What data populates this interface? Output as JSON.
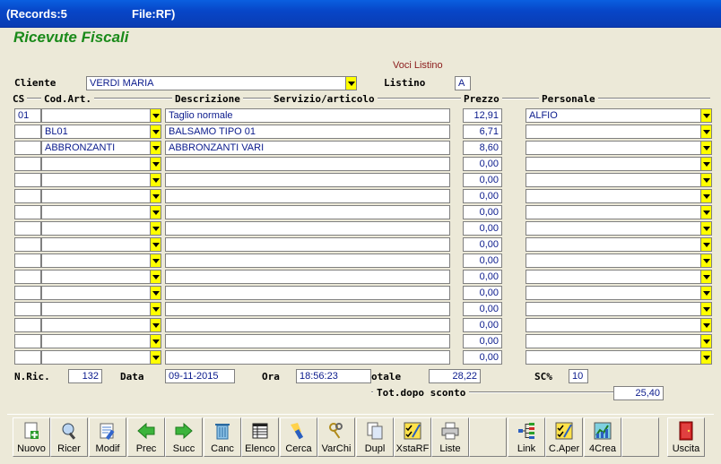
{
  "window": {
    "records": "(Records:5",
    "file": "File:RF)"
  },
  "app_title": "Ricevute Fiscali",
  "voci_listino": "Voci Listino",
  "cliente": {
    "label": "Cliente",
    "value": "VERDI MARIA"
  },
  "listino": {
    "label": "Listino",
    "value": "A"
  },
  "columns": {
    "cs": "CS",
    "cod": "Cod.Art.",
    "desc": "Descrizione",
    "serv": "Servizio/articolo",
    "prezzo": "Prezzo",
    "pers": "Personale"
  },
  "rows": [
    {
      "cs": "01",
      "cod": "",
      "desc": "Taglio normale",
      "prezzo": "12,91",
      "pers": "ALFIO"
    },
    {
      "cs": "",
      "cod": "BL01",
      "desc": "BALSAMO TIPO 01",
      "prezzo": "6,71",
      "pers": ""
    },
    {
      "cs": "",
      "cod": "ABBRONZANTI",
      "desc": "ABBRONZANTI VARI",
      "prezzo": "8,60",
      "pers": ""
    },
    {
      "cs": "",
      "cod": "",
      "desc": "",
      "prezzo": "0,00",
      "pers": ""
    },
    {
      "cs": "",
      "cod": "",
      "desc": "",
      "prezzo": "0,00",
      "pers": ""
    },
    {
      "cs": "",
      "cod": "",
      "desc": "",
      "prezzo": "0,00",
      "pers": ""
    },
    {
      "cs": "",
      "cod": "",
      "desc": "",
      "prezzo": "0,00",
      "pers": ""
    },
    {
      "cs": "",
      "cod": "",
      "desc": "",
      "prezzo": "0,00",
      "pers": ""
    },
    {
      "cs": "",
      "cod": "",
      "desc": "",
      "prezzo": "0,00",
      "pers": ""
    },
    {
      "cs": "",
      "cod": "",
      "desc": "",
      "prezzo": "0,00",
      "pers": ""
    },
    {
      "cs": "",
      "cod": "",
      "desc": "",
      "prezzo": "0,00",
      "pers": ""
    },
    {
      "cs": "",
      "cod": "",
      "desc": "",
      "prezzo": "0,00",
      "pers": ""
    },
    {
      "cs": "",
      "cod": "",
      "desc": "",
      "prezzo": "0,00",
      "pers": ""
    },
    {
      "cs": "",
      "cod": "",
      "desc": "",
      "prezzo": "0,00",
      "pers": ""
    },
    {
      "cs": "",
      "cod": "",
      "desc": "",
      "prezzo": "0,00",
      "pers": ""
    },
    {
      "cs": "",
      "cod": "",
      "desc": "",
      "prezzo": "0,00",
      "pers": ""
    }
  ],
  "footer": {
    "nric_label": "N.Ric.",
    "nric": "132",
    "data_label": "Data",
    "data": "09-11-2015",
    "ora_label": "Ora",
    "ora": "18:56:23",
    "totale_label": "otale",
    "totale": "28,22",
    "sc_label": "SC%",
    "sc": "10",
    "tot_dopo_label": "Tot.dopo sconto",
    "tot_dopo": "25,40"
  },
  "toolbar": [
    {
      "name": "nuovo-button",
      "icon": "new-doc-icon",
      "label": "Nuovo"
    },
    {
      "name": "ricer-button",
      "icon": "magnifier-icon",
      "label": "Ricer"
    },
    {
      "name": "modif-button",
      "icon": "edit-doc-icon",
      "label": "Modif"
    },
    {
      "name": "prec-button",
      "icon": "arrow-left-icon",
      "label": "Prec"
    },
    {
      "name": "succ-button",
      "icon": "arrow-right-icon",
      "label": "Succ"
    },
    {
      "name": "canc-button",
      "icon": "trash-icon",
      "label": "Canc"
    },
    {
      "name": "elenco-button",
      "icon": "table-icon",
      "label": "Elenco"
    },
    {
      "name": "cerca-button",
      "icon": "flashlight-icon",
      "label": "Cerca"
    },
    {
      "name": "varchi-button",
      "icon": "keys-icon",
      "label": "VarChi"
    },
    {
      "name": "dupl-button",
      "icon": "copy-icon",
      "label": "Dupl"
    },
    {
      "name": "xstarf-button",
      "icon": "checklist-icon",
      "label": "XstaRF"
    },
    {
      "name": "liste-button",
      "icon": "printer-icon",
      "label": "Liste"
    },
    {
      "name": "link-button",
      "icon": "tree-icon",
      "label": "Link"
    },
    {
      "name": "caper-button",
      "icon": "checklist-icon",
      "label": "C.Aper"
    },
    {
      "name": "4crea-button",
      "icon": "chart-icon",
      "label": "4Crea"
    },
    {
      "name": "uscita-button",
      "icon": "exit-door-icon",
      "label": "Uscita"
    }
  ]
}
